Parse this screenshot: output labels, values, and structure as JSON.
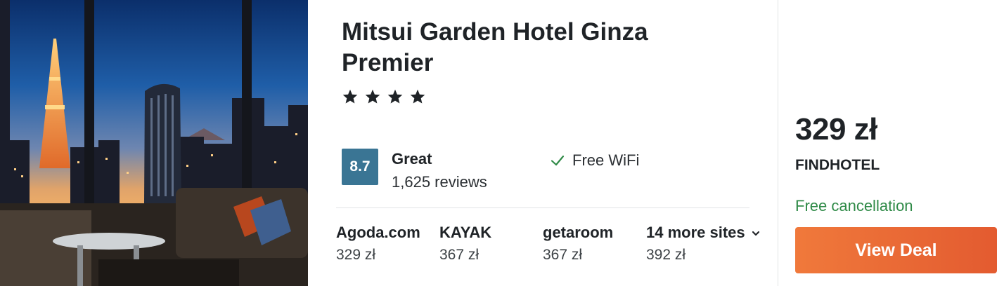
{
  "hotel": {
    "name": "Mitsui Garden Hotel Ginza Premier",
    "star_count": 4,
    "star_icon": "star-icon",
    "rating": {
      "score": "8.7",
      "label": "Great",
      "reviews": "1,625 reviews",
      "badge_color": "#3a7594"
    },
    "amenities": [
      {
        "icon": "check-icon",
        "label": "Free WiFi"
      }
    ]
  },
  "sites": [
    {
      "name": "Agoda.com",
      "price": "329 zł"
    },
    {
      "name": "KAYAK",
      "price": "367 zł"
    },
    {
      "name": "getaroom",
      "price": "367 zł"
    },
    {
      "name": "14 more sites",
      "price": "392 zł",
      "icon": "chevron-down-icon"
    }
  ],
  "deal": {
    "price": "329 zł",
    "provider": "FINDHOTEL",
    "cancellation": "Free cancellation",
    "button_label": "View Deal",
    "button_color": "#e9673a",
    "cancellation_color": "#2f8a47"
  }
}
